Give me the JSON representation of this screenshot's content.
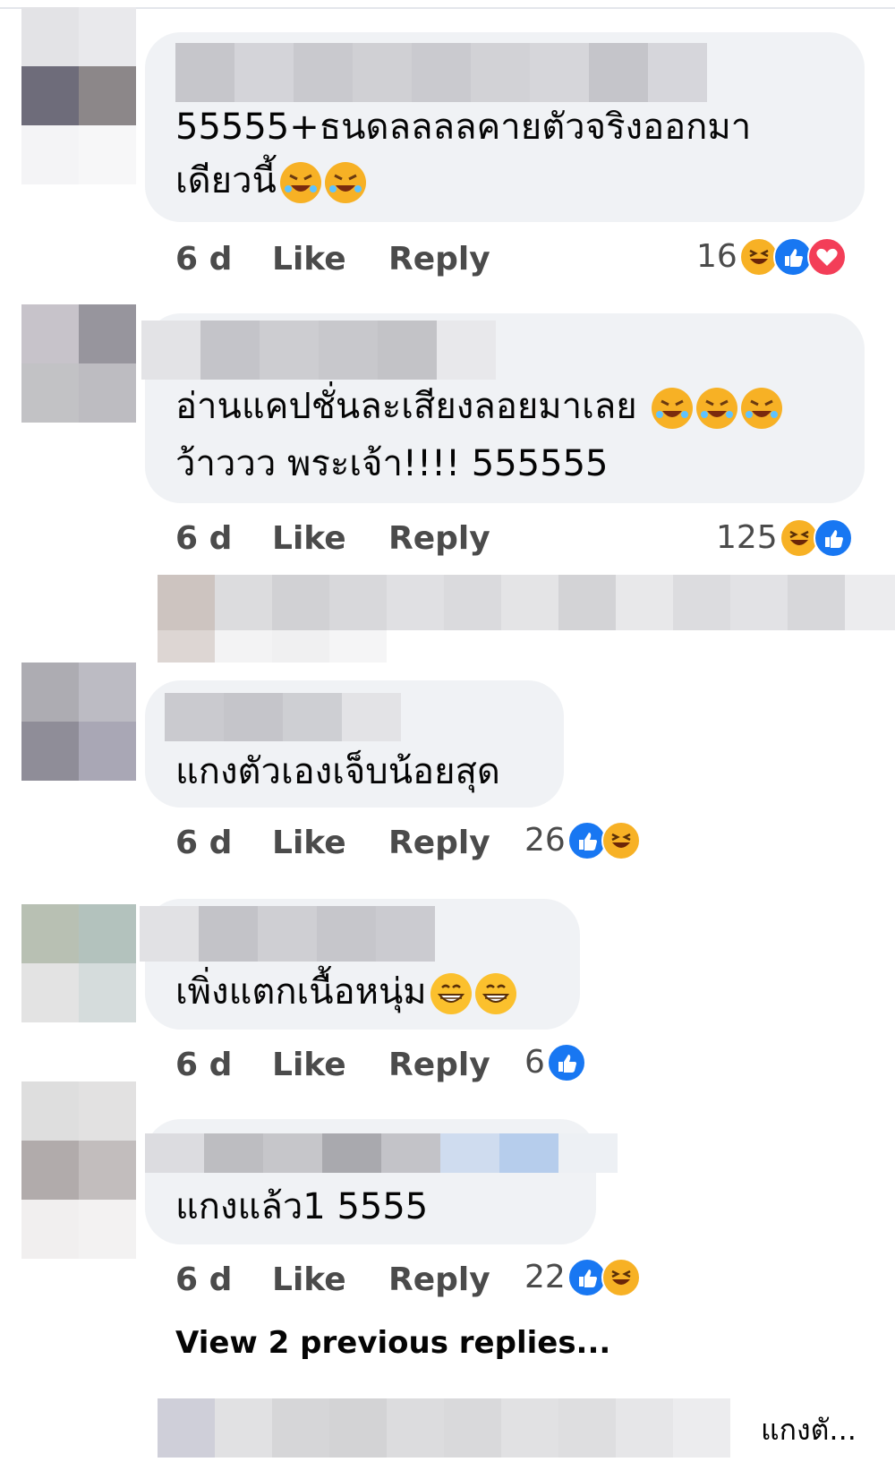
{
  "comments": [
    {
      "text_lines": [
        "55555+ธนดลลลลคายตัวจริงออกมา",
        "เดียวนี้"
      ],
      "time": "6 d",
      "like": "Like",
      "reply": "Reply",
      "reaction_count": "16",
      "reactions": [
        "haha-icon",
        "like-icon",
        "love-icon"
      ]
    },
    {
      "text_lines": [
        "อ่านแคปชั่นละเสียงลอยมาเลย",
        "ว้าววว พระเจ้า!!!! 555555"
      ],
      "time": "6 d",
      "like": "Like",
      "reply": "Reply",
      "reaction_count": "125",
      "reactions": [
        "haha-icon",
        "like-icon"
      ]
    },
    {
      "text_lines": [
        "แกงตัวเองเจ็บน้อยสุด"
      ],
      "time": "6 d",
      "like": "Like",
      "reply": "Reply",
      "reaction_count": "26",
      "reactions": [
        "like-icon",
        "haha-icon"
      ]
    },
    {
      "text_lines": [
        "เพิ่งแตกเนื้อหนุ่ม"
      ],
      "time": "6 d",
      "like": "Like",
      "reply": "Reply",
      "reaction_count": "6",
      "reactions": [
        "like-icon"
      ]
    },
    {
      "text_lines": [
        "แกงแล้ว1 5555"
      ],
      "time": "6 d",
      "like": "Like",
      "reply": "Reply",
      "reaction_count": "22",
      "reactions": [
        "like-icon",
        "haha-icon"
      ]
    }
  ],
  "view_previous": "View 2 previous replies...",
  "trailing_reply_text": "แกงตั...",
  "colors": {
    "bubble": "#f0f2f5",
    "like": "#1877f2",
    "haha": "#f7b125",
    "love": "#f33e58",
    "meta_text": "#4b4b4b"
  }
}
